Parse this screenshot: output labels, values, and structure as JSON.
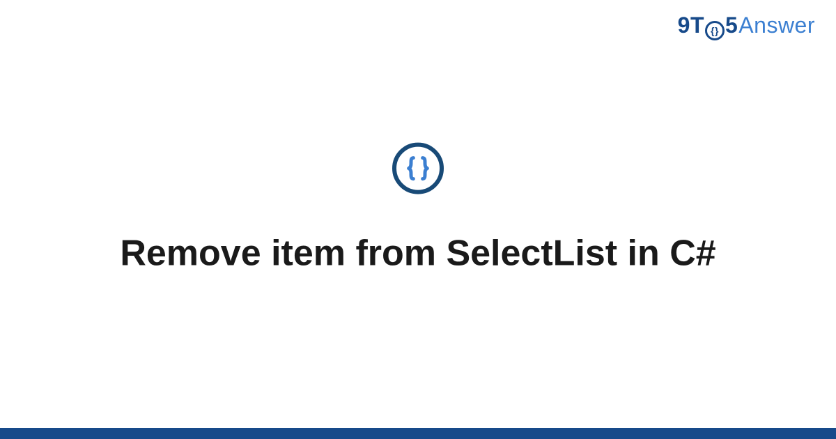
{
  "logo": {
    "part1": "9T",
    "o_inner": "{}",
    "part2": "5",
    "part3": "Answer"
  },
  "main": {
    "title": "Remove item from SelectList in C#"
  },
  "colors": {
    "brand_dark": "#174a8a",
    "brand_light": "#3b7fd1",
    "icon_border": "#184a77",
    "icon_braces": "#3b7fd1"
  }
}
